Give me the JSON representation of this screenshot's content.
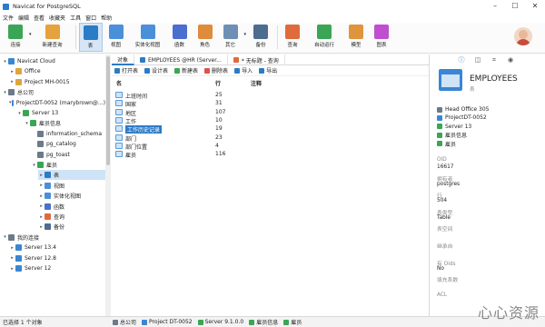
{
  "window": {
    "title": "Navicat for PostgreSQL"
  },
  "menu": [
    "文件",
    "编辑",
    "查看",
    "收藏夹",
    "工具",
    "窗口",
    "帮助"
  ],
  "toolbar": [
    {
      "label": "连接",
      "icon": "connect-icon",
      "color": "#3aa655",
      "drop": true
    },
    {
      "label": "新建查询",
      "icon": "new-query-icon",
      "color": "#e6a23c"
    },
    {
      "label": "表",
      "icon": "table-icon",
      "color": "#2b7bc7",
      "active": true
    },
    {
      "label": "视图",
      "icon": "view-icon",
      "color": "#4a90d9"
    },
    {
      "label": "实体化视图",
      "icon": "materialized-view-icon",
      "color": "#4a90d9"
    },
    {
      "label": "函数",
      "icon": "function-icon",
      "color": "#4a6fd1"
    },
    {
      "label": "角色",
      "icon": "role-icon",
      "color": "#e08a3c"
    },
    {
      "label": "其它",
      "icon": "other-icon",
      "color": "#6d8fb5",
      "drop": true
    },
    {
      "label": "备份",
      "icon": "backup-icon",
      "color": "#4d6d8f"
    },
    {
      "label": "查询",
      "icon": "query-icon",
      "color": "#e06a3c"
    },
    {
      "label": "自动运行",
      "icon": "automation-icon",
      "color": "#3aa655"
    },
    {
      "label": "模型",
      "icon": "model-icon",
      "color": "#e0953c"
    },
    {
      "label": "图表",
      "icon": "chart-icon",
      "color": "#c04fd0"
    }
  ],
  "tree": [
    {
      "label": "Navicat Cloud",
      "level": 0,
      "arrow": "v",
      "icon": "cloud-icon",
      "color": "#3a86d4"
    },
    {
      "label": "Office",
      "level": 1,
      "arrow": ">",
      "icon": "office-icon",
      "color": "#e0a33c"
    },
    {
      "label": "Project MH-0015",
      "level": 1,
      "arrow": ">",
      "icon": "project-icon",
      "color": "#e0a33c"
    },
    {
      "label": "总公司",
      "level": 0,
      "arrow": "v",
      "icon": "computer-icon",
      "color": "#6c7a89"
    },
    {
      "label": "ProjectDT-0052 (marybrown@...)",
      "level": 1,
      "arrow": "v",
      "icon": "project-icon",
      "color": "#3a86d4"
    },
    {
      "label": "Server 13",
      "level": 2,
      "arrow": "v",
      "icon": "server-icon",
      "color": "#3aa655"
    },
    {
      "label": "雇员信息",
      "level": 3,
      "arrow": "v",
      "icon": "database-icon",
      "color": "#3aa655"
    },
    {
      "label": "information_schema",
      "level": 4,
      "arrow": "",
      "icon": "schema-icon",
      "color": "#6c7a89"
    },
    {
      "label": "pg_catalog",
      "level": 4,
      "arrow": "",
      "icon": "schema-icon",
      "color": "#6c7a89"
    },
    {
      "label": "pg_toast",
      "level": 4,
      "arrow": "",
      "icon": "schema-icon",
      "color": "#6c7a89"
    },
    {
      "label": "雇员",
      "level": 4,
      "arrow": "v",
      "icon": "schema-icon",
      "color": "#3aa655"
    },
    {
      "label": "表",
      "level": 5,
      "arrow": ">",
      "icon": "table-icon",
      "color": "#2b7bc7",
      "selected": true
    },
    {
      "label": "视图",
      "level": 5,
      "arrow": ">",
      "icon": "view-icon",
      "color": "#4a90d9"
    },
    {
      "label": "实体化视图",
      "level": 5,
      "arrow": ">",
      "icon": "materialized-view-icon",
      "color": "#4a90d9"
    },
    {
      "label": "函数",
      "level": 5,
      "arrow": ">",
      "icon": "function-icon",
      "color": "#4a6fd1"
    },
    {
      "label": "查询",
      "level": 5,
      "arrow": ">",
      "icon": "query-icon",
      "color": "#e06a3c"
    },
    {
      "label": "备份",
      "level": 5,
      "arrow": ">",
      "icon": "backup-icon",
      "color": "#4d6d8f"
    },
    {
      "label": "我的连接",
      "level": 0,
      "arrow": "v",
      "icon": "computer-icon",
      "color": "#6c7a89"
    },
    {
      "label": "Server 13.4",
      "level": 1,
      "arrow": ">",
      "icon": "server-icon",
      "color": "#3a86d4"
    },
    {
      "label": "Server 12.8",
      "level": 1,
      "arrow": ">",
      "icon": "server-icon",
      "color": "#3a86d4"
    },
    {
      "label": "Server 12",
      "level": 1,
      "arrow": ">",
      "icon": "server-icon",
      "color": "#3a86d4"
    }
  ],
  "tabs": [
    {
      "label": "对象",
      "icon": ""
    },
    {
      "label": "EMPLOYEES @HR (Server...",
      "icon": "table-icon",
      "color": "#2b7bc7"
    },
    {
      "label": "* 无标题 - 查询",
      "icon": "query-icon",
      "color": "#e06a3c"
    }
  ],
  "objtoolbar": [
    {
      "label": "打开表",
      "icon": "open-table-icon",
      "color": "#2b7bc7"
    },
    {
      "label": "设计表",
      "icon": "design-table-icon",
      "color": "#2b7bc7"
    },
    {
      "label": "新建表",
      "icon": "new-table-icon",
      "color": "#3aa655"
    },
    {
      "label": "删除表",
      "icon": "delete-table-icon",
      "color": "#d9534f"
    },
    {
      "label": "导入",
      "icon": "import-icon",
      "color": "#2b7bc7"
    },
    {
      "label": "导出",
      "icon": "export-icon",
      "color": "#2b7bc7"
    }
  ],
  "columns": {
    "name": "名",
    "rows": "行",
    "comment": "注释"
  },
  "objects": [
    {
      "name": "上班时间",
      "rows": "25"
    },
    {
      "name": "国家",
      "rows": "31"
    },
    {
      "name": "地区",
      "rows": "107"
    },
    {
      "name": "工作",
      "rows": "10"
    },
    {
      "name": "工作历史记录",
      "rows": "19",
      "selected": true
    },
    {
      "name": "部门",
      "rows": "23"
    },
    {
      "name": "部门位置",
      "rows": "4"
    },
    {
      "name": "雇员",
      "rows": "116"
    }
  ],
  "info": {
    "title": "EMPLOYEES",
    "subtitle": "表",
    "path": [
      {
        "label": "Head Office 305",
        "icon": "computer-icon",
        "color": "#6c7a89"
      },
      {
        "label": "ProjectDT-0052",
        "icon": "project-icon",
        "color": "#3a86d4"
      },
      {
        "label": "Server 13",
        "icon": "server-icon",
        "color": "#3aa655"
      },
      {
        "label": "雇员信息",
        "icon": "database-icon",
        "color": "#3aa655"
      },
      {
        "label": "雇员",
        "icon": "schema-icon",
        "color": "#3aa655"
      }
    ],
    "props": [
      {
        "label": "OID",
        "value": "16617"
      },
      {
        "label": "拥有者",
        "value": "postgres"
      },
      {
        "label": "行",
        "value": "504"
      },
      {
        "label": "表类型",
        "value": "Table"
      },
      {
        "label": "表空间",
        "value": ""
      },
      {
        "label": "继承自",
        "value": ""
      },
      {
        "label": "有 Oids",
        "value": "No"
      },
      {
        "label": "填充系数",
        "value": ""
      },
      {
        "label": "ACL",
        "value": ""
      }
    ]
  },
  "status": {
    "left": "已选择 1 个对象",
    "crumbs": [
      {
        "label": "总公司",
        "icon": "computer-icon",
        "color": "#6c7a89"
      },
      {
        "label": "Project DT-0052",
        "icon": "project-icon",
        "color": "#3a86d4"
      },
      {
        "label": "Server 9.1.0.0",
        "icon": "server-icon",
        "color": "#3aa655"
      },
      {
        "label": "雇员信息",
        "icon": "database-icon",
        "color": "#3aa655"
      },
      {
        "label": "雇员",
        "icon": "schema-icon",
        "color": "#3aa655"
      }
    ]
  },
  "watermark": "心心资源"
}
